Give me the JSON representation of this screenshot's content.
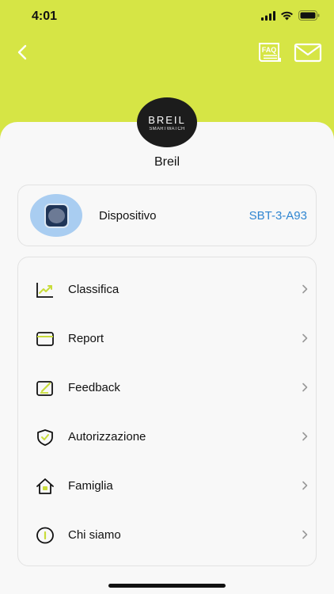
{
  "status_bar": {
    "time": "4:01"
  },
  "nav": {
    "back_icon": "chevron-left-icon",
    "faq_label": "FAQ",
    "mail_icon": "envelope-icon"
  },
  "profile": {
    "logo_main": "BREIL",
    "logo_sub": "SMARTWATCH",
    "brand_name": "Breil"
  },
  "device": {
    "label": "Dispositivo",
    "id": "SBT-3-A93",
    "icon": "watch-icon"
  },
  "menu": {
    "items": [
      {
        "label": "Classifica",
        "icon": "trend-chart-icon"
      },
      {
        "label": "Report",
        "icon": "report-card-icon"
      },
      {
        "label": "Feedback",
        "icon": "feedback-edit-icon"
      },
      {
        "label": "Autorizzazione",
        "icon": "shield-check-icon"
      },
      {
        "label": "Famiglia",
        "icon": "home-icon"
      },
      {
        "label": "Chi siamo",
        "icon": "info-icon"
      }
    ]
  },
  "colors": {
    "header_bg": "#d6e545",
    "accent": "#c8dc3a",
    "link": "#2f86d1",
    "sheet_bg": "#f8f8f8"
  }
}
